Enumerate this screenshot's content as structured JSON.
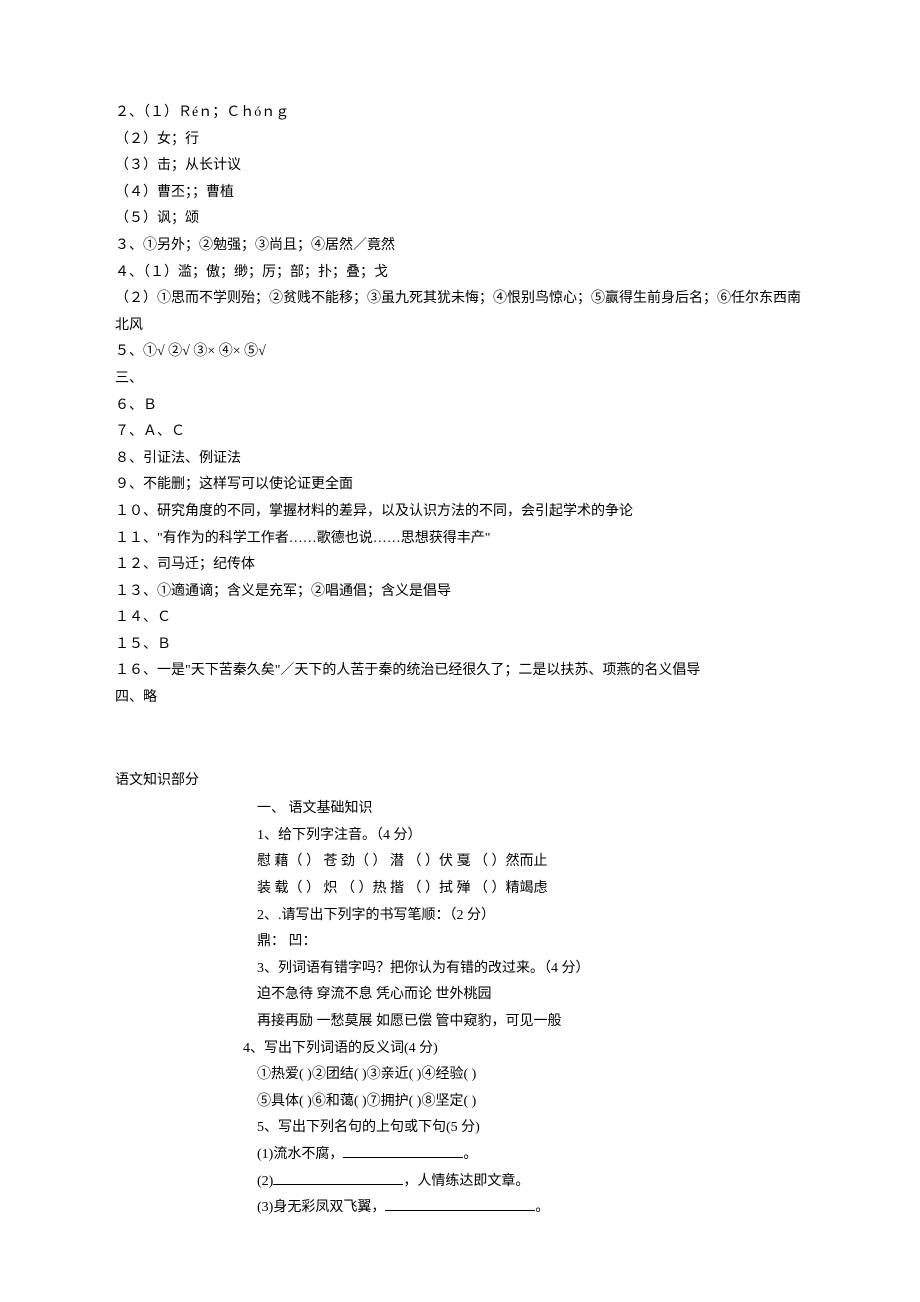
{
  "answers": {
    "l2_1": "２、（１）Ｒéｎ；Ｃｈóｎｇ",
    "l2_2": "（２）女；行",
    "l2_3": "（３）击；从长计议",
    "l2_4": "（４）曹丕；；曹植",
    "l2_5": "（５）讽；颂",
    "l3": "３、①另外；②勉强；③尚且；④居然／竟然",
    "l4_1": "４、（１）滥；傲；缈；厉；部；扑；叠；戈",
    "l4_2": "（２）①思而不学则殆；②贫贱不能移；③虽九死其犹未悔；④恨别鸟惊心；⑤赢得生前身后名；⑥任尔东西南北风",
    "l5": "５、①√ ②√ ③× ④× ⑤√",
    "sec3": "三、",
    "l6": "６、Ｂ",
    "l7": "７、Ａ、Ｃ",
    "l8": "８、引证法、例证法",
    "l9": "９、不能删；这样写可以使论证更全面",
    "l10": "１０、研究角度的不同，掌握材料的差异，以及认识方法的不同，会引起学术的争论",
    "l11": "１１、\"有作为的科学工作者……歌德也说……思想获得丰产\"",
    "l12": "１２、司马迁；纪传体",
    "l13": "１３、①適通谪；含义是充军；②唱通倡；含义是倡导",
    "l14": "１４、Ｃ",
    "l15": "１５、Ｂ",
    "l16": "１６、一是\"天下苦秦久矣\"／天下的人苦于秦的统治已经很久了；二是以扶苏、项燕的名义倡导",
    "sec4": "四、略"
  },
  "knowledge": {
    "title": "语文知识部分",
    "h1": "一、 语文基础知识",
    "q1": "1、给下列字注音。（4 分）",
    "q1_l1": "慰 藉（  ）  苍 劲（  ）  潜 （  ）伏  戛 （  ）然而止",
    "q1_l2": "装 载（  ）  炽 （  ）热  揩 （  ）拭  殚 （  ）精竭虑",
    "q2": "2、.请写出下列字的书写笔顺：（2 分）",
    "q2_l1": "鼎：  凹：",
    "q3": "3、列词语有错字吗？把你认为有错的改过来。（4 分）",
    "q3_l1": "迫不急待  穿流不息  凭心而论  世外桃园",
    "q3_l2": "再接再励  一愁莫展  如愿已偿  管中窥豹，可见一般",
    "q4": "4、写出下列词语的反义词(4 分)",
    "q4_l1": "①热爱(  )②团结(  )③亲近(  )④经验(  )",
    "q4_l2": "⑤具体(  )⑥和蔼(  )⑦拥护(  )⑧坚定(  )",
    "q5": "5、写出下列名句的上句或下句(5 分)",
    "q5_1a": "(1)流水不腐，",
    "q5_1b": "。",
    "q5_2a": "(2)",
    "q5_2b": "，人情练达即文章。",
    "q5_3a": "(3)身无彩凤双飞翼，",
    "q5_3b": "。"
  }
}
